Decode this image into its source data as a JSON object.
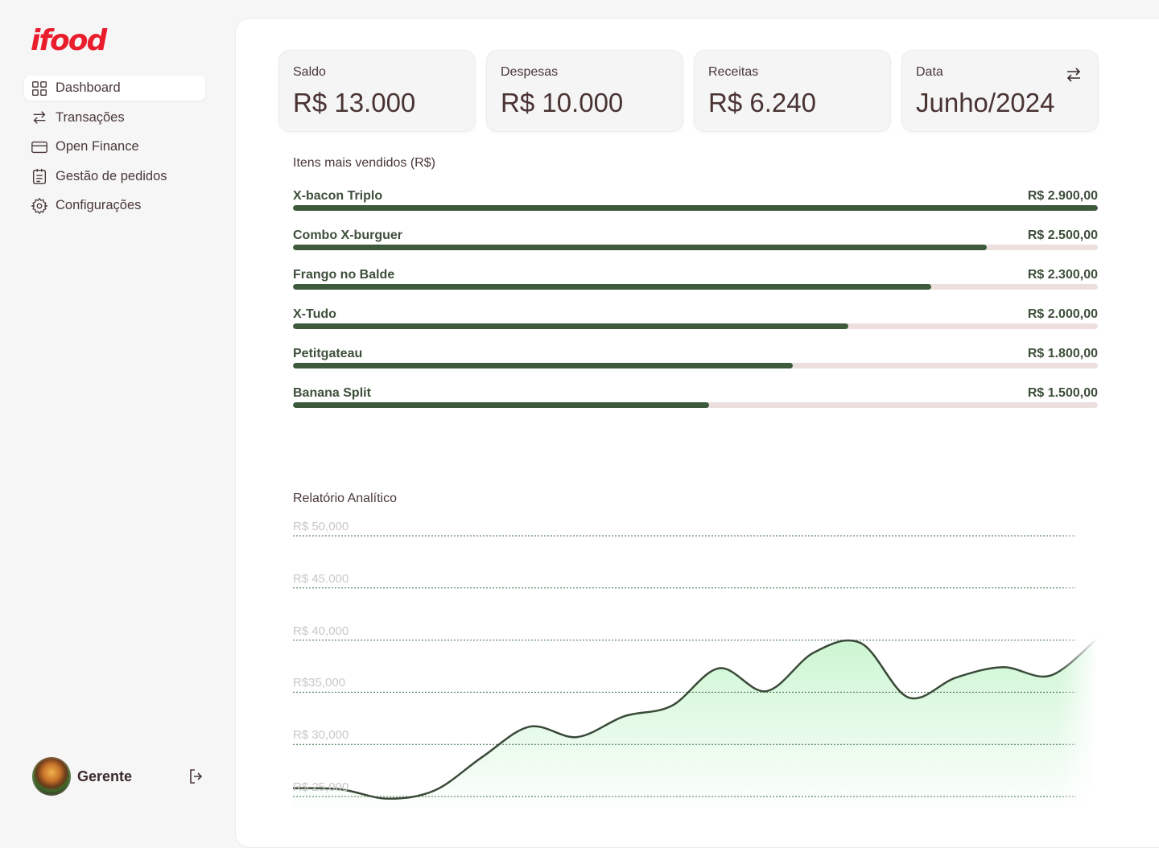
{
  "brand": {
    "logo_text": "ifood",
    "accent": "#ea1d2c"
  },
  "sidebar": {
    "items": [
      {
        "label": "Dashboard",
        "icon": "grid-icon",
        "active": true
      },
      {
        "label": "Transações",
        "icon": "swap-arrows-icon",
        "active": false
      },
      {
        "label": "Open Finance",
        "icon": "credit-card-icon",
        "active": false
      },
      {
        "label": "Gestão de pedidos",
        "icon": "clipboard-icon",
        "active": false
      },
      {
        "label": "Configurações",
        "icon": "gear-icon",
        "active": false
      }
    ],
    "user": {
      "name": "Gerente",
      "avatar": "burger-avatar",
      "logout_icon": "logout-icon"
    }
  },
  "cards": [
    {
      "label": "Saldo",
      "value": "R$ 13.000"
    },
    {
      "label": "Despesas",
      "value": "R$ 10.000"
    },
    {
      "label": "Receitas",
      "value": "R$ 6.240"
    },
    {
      "label": "Data",
      "value": "Junho/2024",
      "icon": "swap-arrows-icon"
    }
  ],
  "top_items": {
    "title": "Itens mais vendidos (R$)",
    "max": 2900,
    "colors": {
      "fill": "#3d5a3c",
      "track": "#ecdfdd"
    },
    "rows": [
      {
        "name": "X-bacon Triplo",
        "value_label": "R$ 2.900,00",
        "value": 2900
      },
      {
        "name": "Combo X-burguer",
        "value_label": "R$ 2.500,00",
        "value": 2500
      },
      {
        "name": "Frango no Balde",
        "value_label": "R$ 2.300,00",
        "value": 2300
      },
      {
        "name": "X-Tudo",
        "value_label": "R$ 2.000,00",
        "value": 2000
      },
      {
        "name": "Petitgateau",
        "value_label": "R$ 1.800,00",
        "value": 1800
      },
      {
        "name": "Banana Split",
        "value_label": "R$ 1.500,00",
        "value": 1500
      }
    ]
  },
  "report": {
    "title": "Relatório Analítico"
  },
  "chart_data": {
    "type": "area",
    "title": "Relatório Analítico",
    "xlabel": "",
    "ylabel": "",
    "ylim": [
      24000,
      51000
    ],
    "grid": true,
    "yticks": [
      {
        "label": "R$ 50,000",
        "value": 50000
      },
      {
        "label": "R$ 45.000",
        "value": 45000
      },
      {
        "label": "R$ 40,000",
        "value": 40000
      },
      {
        "label": "R$35,000",
        "value": 35000
      },
      {
        "label": "R$ 30,000",
        "value": 30000
      },
      {
        "label": "R$ 25,000",
        "value": 25000
      }
    ],
    "x": [
      0,
      1,
      2,
      3,
      4,
      5,
      6,
      7,
      8,
      9,
      10,
      11,
      12,
      13,
      14,
      15,
      16,
      17
    ],
    "series": [
      {
        "values": [
          25800,
          25700,
          24800,
          25600,
          28800,
          31700,
          30700,
          32700,
          33700,
          37300,
          35100,
          38800,
          39700,
          34500,
          36400,
          37400,
          36600,
          40200
        ]
      }
    ],
    "colors": {
      "line": "#3a4a38",
      "fill_top": "#c9f5cf",
      "grid": "#3f6f45"
    }
  }
}
